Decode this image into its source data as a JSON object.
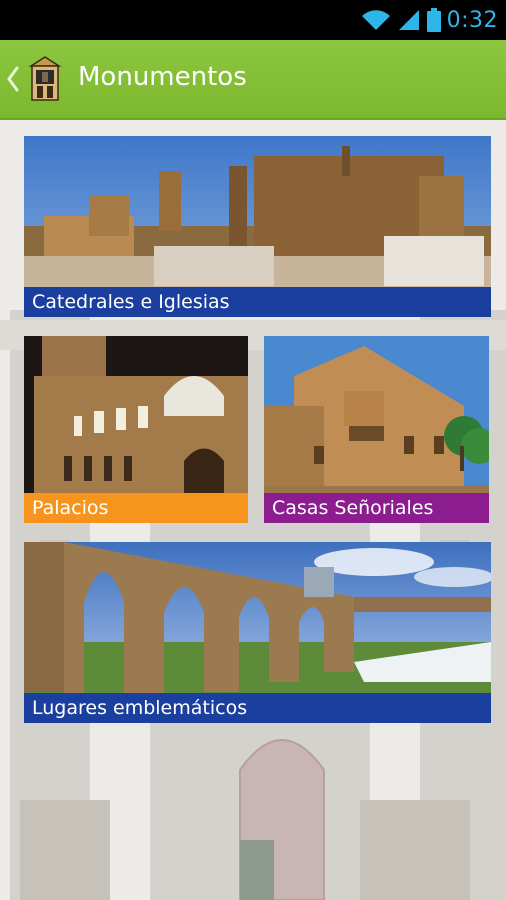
{
  "status_bar": {
    "time": "0:32"
  },
  "action_bar": {
    "title": "Monumentos"
  },
  "tiles": [
    {
      "label": "Catedrales e Iglesias",
      "color": "#1b3f9e"
    },
    {
      "label": "Palacios",
      "color": "#f7941d"
    },
    {
      "label": "Casas Señoriales",
      "color": "#8b1d8e"
    },
    {
      "label": "Lugares emblemáticos",
      "color": "#1b3f9e"
    }
  ],
  "colors": {
    "action_bar": "#7cb82e",
    "status_accent": "#2fb6e8"
  },
  "icons": [
    "wifi-icon",
    "signal-icon",
    "battery-icon",
    "back-chevron-icon",
    "app-logo-icon"
  ]
}
